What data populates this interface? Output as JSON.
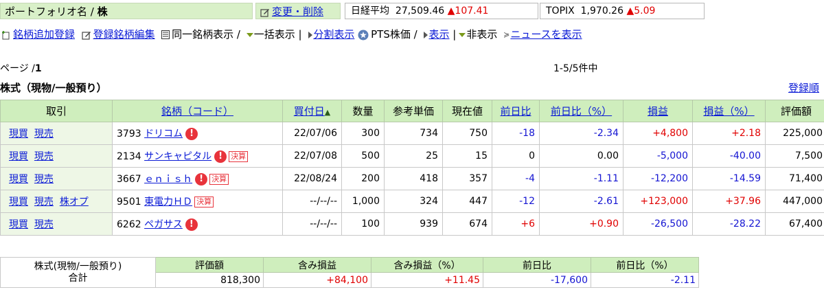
{
  "header": {
    "portfolio_label": "ポートフォリオ名 / ",
    "portfolio_name": "株",
    "edit_link": "変更・削除",
    "nikkei": {
      "name": "日経平均",
      "value": "27,509.46",
      "change": "107.41"
    },
    "topix": {
      "name": "TOPIX",
      "value": "1,970.26",
      "change": "5.09"
    },
    "up_color": "#e00000"
  },
  "toolbar": {
    "add": "銘柄追加登録",
    "edit": "登録銘柄編集",
    "same": "同一銘柄表示 /",
    "bulk": "一括表示 |",
    "split": "分割表示",
    "pts": "PTS株価 /",
    "show": "表示",
    "sep": "|",
    "hide": "非表示",
    "news": "ニュースを表示"
  },
  "paging": {
    "page": "ページ /",
    "page_num": "1",
    "count": "1-5/5件中"
  },
  "section": {
    "title": "株式（現物/一般預り）",
    "sort_link": "登録順"
  },
  "table": {
    "headers": {
      "trade": "取引",
      "brand": "銘柄（コード）",
      "buy_date": "買付日",
      "qty": "数量",
      "ref_price": "参考単価",
      "current": "現在値",
      "day_change": "前日比",
      "day_change_pct": "前日比（%）",
      "profit": "損益",
      "profit_pct": "損益（%）",
      "valuation": "評価額"
    },
    "actions": {
      "buy": "現買",
      "sell": "現売",
      "option": "株オプ"
    },
    "rows": [
      {
        "code": "3793",
        "name": "ドリコム",
        "warn": true,
        "kessan": false,
        "date": "22/07/06",
        "qty": "300",
        "ref": "734",
        "cur": "750",
        "chg": "-18",
        "chg_pct": "-2.34",
        "pl": "+4,800",
        "pl_pct": "+2.18",
        "val": "225,000",
        "option": false
      },
      {
        "code": "2134",
        "name": "サンキャピタル",
        "warn": true,
        "kessan": true,
        "date": "22/07/08",
        "qty": "500",
        "ref": "25",
        "cur": "15",
        "chg": "0",
        "chg_pct": "0.00",
        "pl": "-5,000",
        "pl_pct": "-40.00",
        "val": "7,500",
        "option": false
      },
      {
        "code": "3667",
        "name": "ｅｎｉｓｈ",
        "warn": true,
        "kessan": true,
        "date": "22/08/24",
        "qty": "200",
        "ref": "418",
        "cur": "357",
        "chg": "-4",
        "chg_pct": "-1.11",
        "pl": "-12,200",
        "pl_pct": "-14.59",
        "val": "71,400",
        "option": false
      },
      {
        "code": "9501",
        "name": "東電力ＨＤ",
        "warn": false,
        "kessan": true,
        "date": "--/--/--",
        "qty": "1,000",
        "ref": "324",
        "cur": "447",
        "chg": "-12",
        "chg_pct": "-2.61",
        "pl": "+123,000",
        "pl_pct": "+37.96",
        "val": "447,000",
        "option": true
      },
      {
        "code": "6262",
        "name": "ペガサス",
        "warn": true,
        "kessan": false,
        "date": "--/--/--",
        "qty": "100",
        "ref": "939",
        "cur": "674",
        "chg": "+6",
        "chg_pct": "+0.90",
        "pl": "-26,500",
        "pl_pct": "-28.22",
        "val": "67,400",
        "option": false
      }
    ],
    "kessan_label": "決算",
    "warn_label": "!"
  },
  "summary": {
    "label_line1": "株式(現物/一般預り)",
    "label_line2": "合計",
    "headers": {
      "val": "評価額",
      "pl": "含み損益",
      "pl_pct": "含み損益（%）",
      "chg": "前日比",
      "chg_pct": "前日比（%）"
    },
    "values": {
      "val": "818,300",
      "pl": "+84,100",
      "pl_pct": "+11.45",
      "chg": "-17,600",
      "chg_pct": "-2.11"
    }
  }
}
